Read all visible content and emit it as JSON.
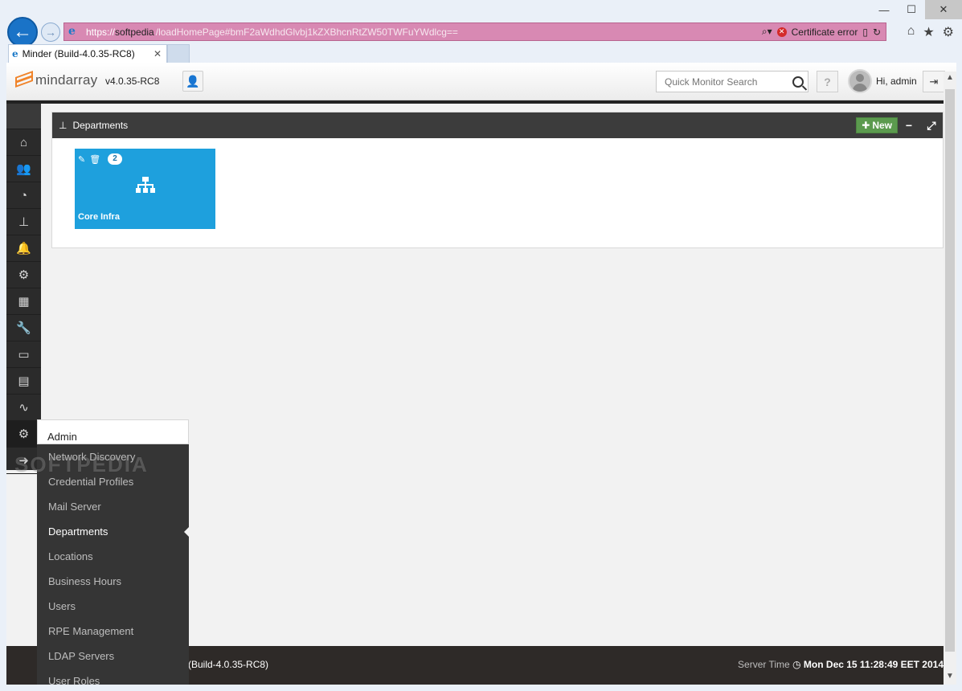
{
  "browser": {
    "url_scheme": "https://",
    "url_host": "softpedia",
    "url_path": "/loadHomePage#bmF2aWdhdGlvbj1kZXBhcnRtZW50TWFuYWdlcg==",
    "cert_error": "Certificate error",
    "tab_title": "Minder (Build-4.0.35-RC8)"
  },
  "header": {
    "logo_text": "mindarray",
    "version": "v4.0.35-RC8",
    "search_placeholder": "Quick Monitor Search",
    "help_label": "?",
    "greeting": "Hi, admin"
  },
  "sidebar": {
    "items": [
      {
        "icon": "home-icon",
        "glyph": "⌂"
      },
      {
        "icon": "users-icon",
        "glyph": "👥"
      },
      {
        "icon": "dashboard-icon",
        "glyph": "◔"
      },
      {
        "icon": "hierarchy-icon",
        "glyph": "⊥"
      },
      {
        "icon": "bell-icon",
        "glyph": "🔔"
      },
      {
        "icon": "gear-icon",
        "glyph": "⚙"
      },
      {
        "icon": "calculator-icon",
        "glyph": "▦"
      },
      {
        "icon": "wrench-icon",
        "glyph": "🔧"
      },
      {
        "icon": "monitor-icon",
        "glyph": "▭"
      },
      {
        "icon": "calendar-icon",
        "glyph": "▤"
      },
      {
        "icon": "chart-icon",
        "glyph": "∿"
      },
      {
        "icon": "gears-icon",
        "glyph": "⚙"
      },
      {
        "icon": "arrow-right-icon",
        "glyph": "➜"
      }
    ]
  },
  "panel": {
    "title": "Departments",
    "new_label": "New",
    "minimize_label": "−",
    "expand_label": "⤢"
  },
  "department_card": {
    "count": "2",
    "name": "Core Infra"
  },
  "admin_menu": {
    "title": "Admin",
    "items": [
      "Network Discovery",
      "Credential Profiles",
      "Mail Server",
      "Departments",
      "Locations",
      "Business Hours",
      "Users",
      "RPE Management",
      "LDAP Servers",
      "User Roles"
    ],
    "active_index": 3
  },
  "watermark": "SOFTPEDIA",
  "footer": {
    "build": "(Build-4.0.35-RC8)",
    "server_time_label": "Server Time",
    "server_time_value": "Mon Dec 15 11:28:49 EET 2014"
  }
}
